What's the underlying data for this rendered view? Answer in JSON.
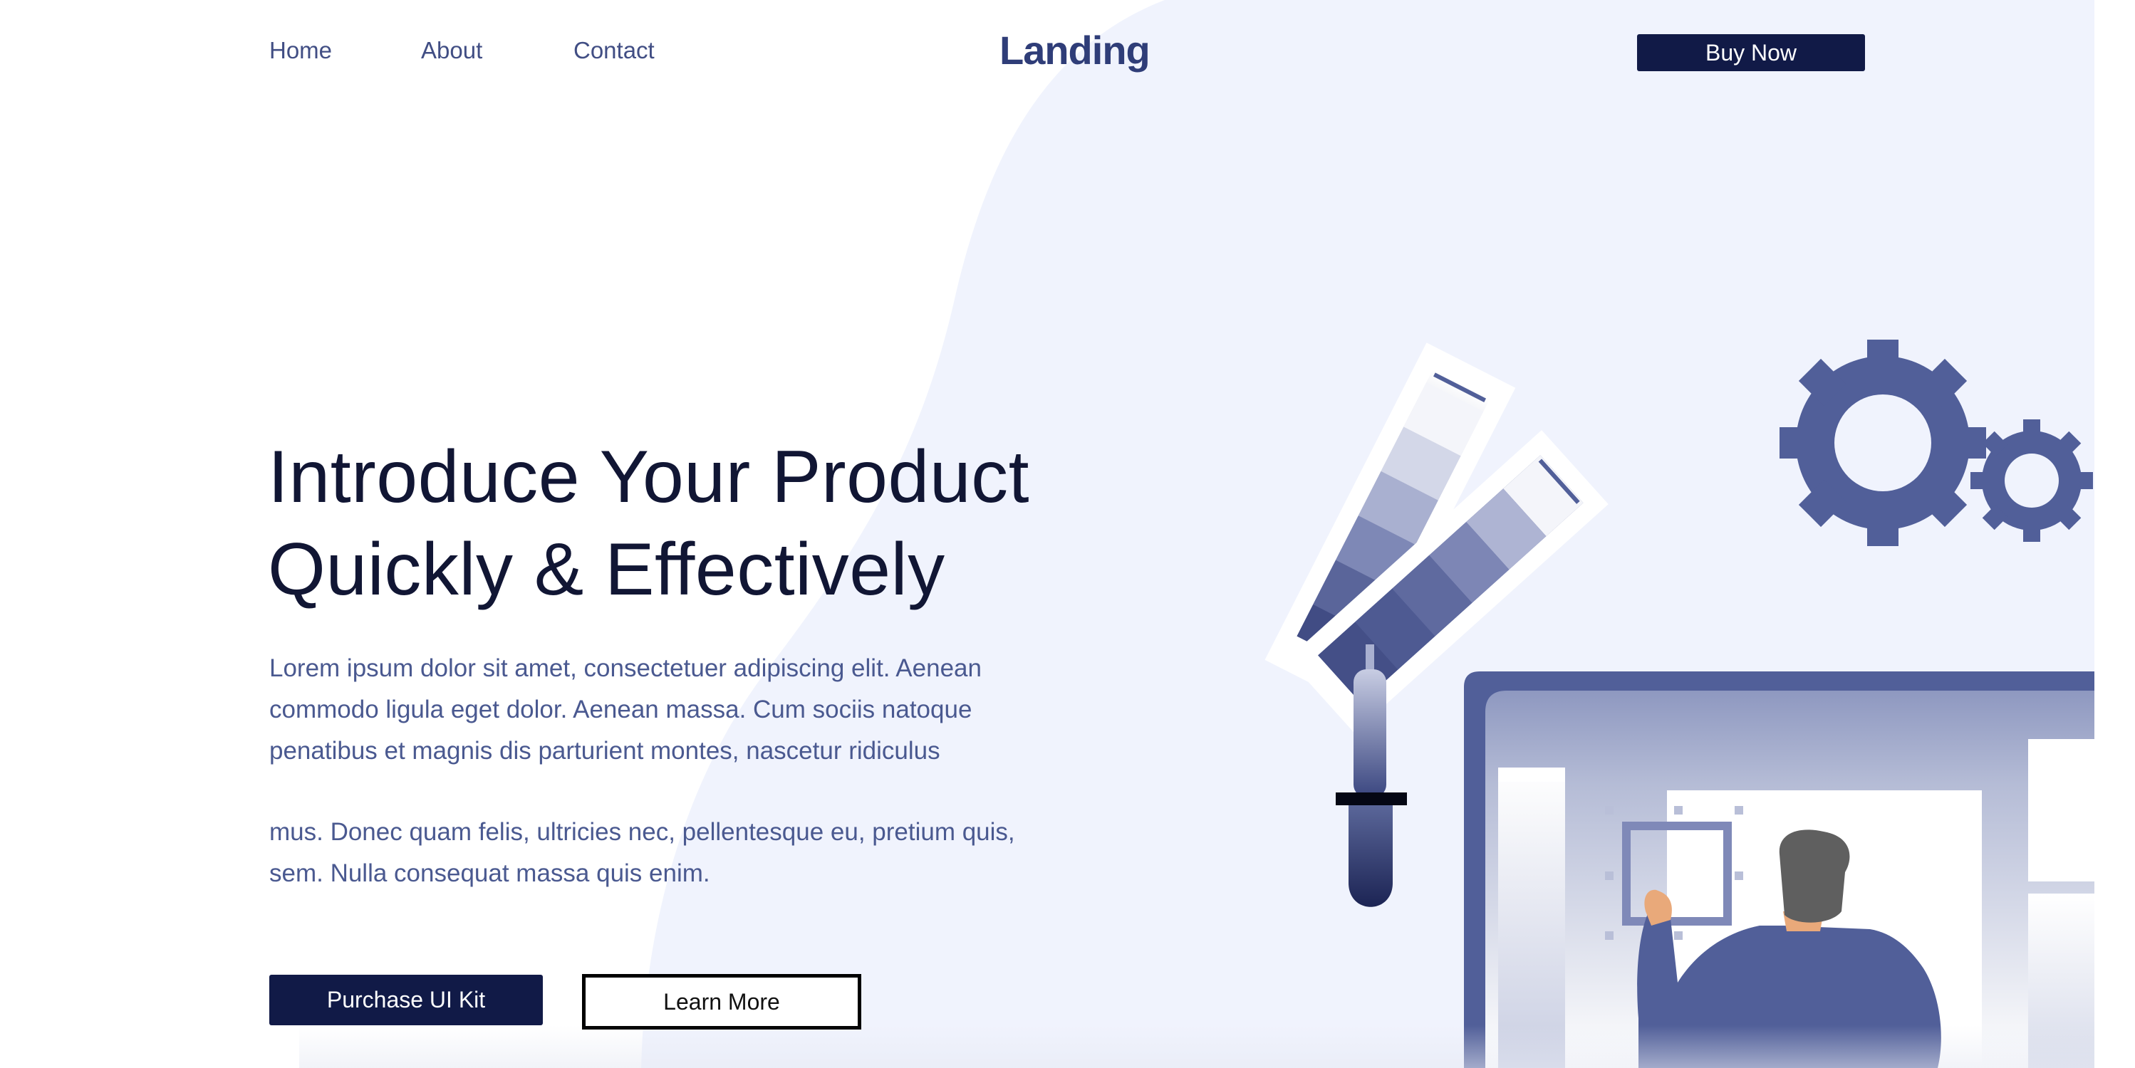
{
  "nav": {
    "links": [
      {
        "label": "Home"
      },
      {
        "label": "About"
      },
      {
        "label": "Contact"
      }
    ],
    "logo": "Landing",
    "buy_now": "Buy Now"
  },
  "hero": {
    "title_line1": "Introduce Your Product",
    "title_line2": "Quickly & Effectively",
    "paragraph1": "Lorem ipsum dolor sit amet, consectetuer adipiscing elit. Aenean commodo ligula eget dolor. Aenean massa. Cum sociis natoque penatibus et magnis dis parturient montes, nascetur ridiculus",
    "paragraph2": "mus. Donec quam felis, ultricies nec, pellentesque eu, pretium quis, sem. Nulla consequat massa quis enim.",
    "primary_button": "Purchase UI Kit",
    "secondary_button": "Learn More"
  },
  "illustration": {
    "icons": [
      "color-swatch-icon",
      "eyedropper-icon",
      "gear-icon",
      "monitor-icon",
      "designer-person-icon"
    ]
  },
  "colors": {
    "primary_dark": "#111a47",
    "heading": "#111634",
    "body_text": "#4a5990",
    "nav_text": "#414e84",
    "accent_illustration": "#515f99",
    "blob_background": "#f0f3fd"
  }
}
